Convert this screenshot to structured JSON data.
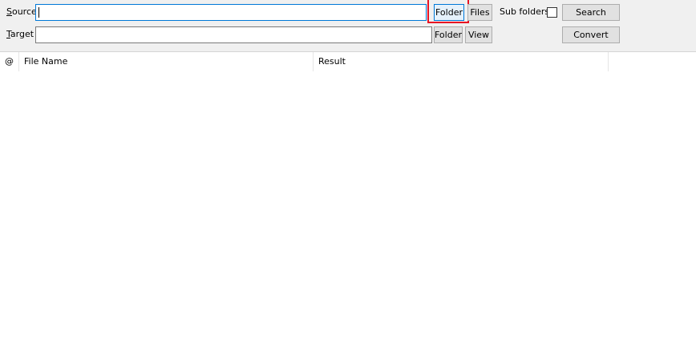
{
  "source": {
    "label_prefix": "",
    "label_accel": "S",
    "label_rest": "ource",
    "value": "",
    "folder_button": "Folder",
    "files_button": "Files",
    "subfolders_label": "Sub folders",
    "subfolders_checked": false,
    "search_button": "Search"
  },
  "target": {
    "label_accel": "T",
    "label_rest": "arget",
    "value": "",
    "folder_button": "Folder",
    "view_button": "View",
    "convert_button": "Convert"
  },
  "list": {
    "columns": [
      "@",
      "File Name",
      "Result"
    ],
    "rows": []
  },
  "colors": {
    "toolbar_bg": "#f0f0f0",
    "focus_border": "#0078d7",
    "highlight": "#e81123"
  }
}
